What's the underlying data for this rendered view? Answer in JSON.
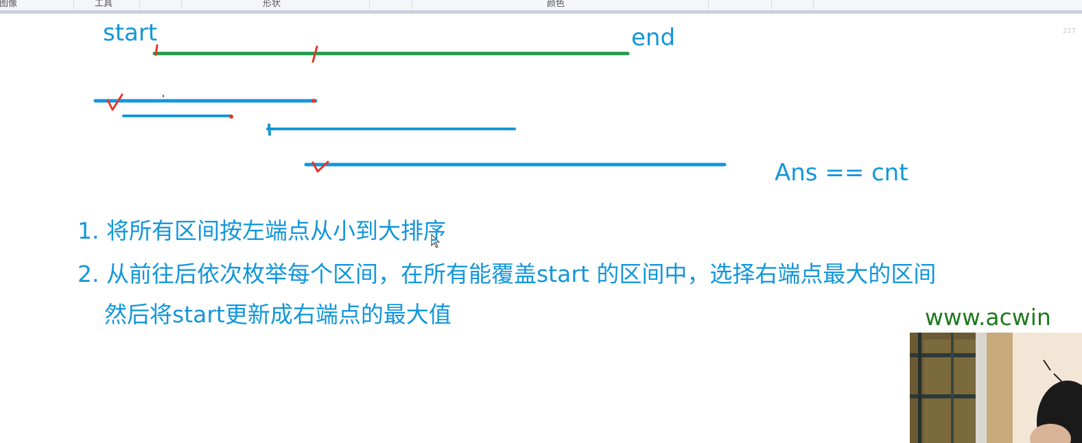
{
  "toolbar": {
    "groups": [
      "图像",
      "工具",
      "形状",
      "颜色"
    ]
  },
  "page_indicator": "227",
  "drawing": {
    "start_label": "start",
    "end_label": "end",
    "formula": "Ans == cnt",
    "colors": {
      "primary_text": "#1296db",
      "target_segment": "#1f9a48",
      "interval_segment": "#1296db",
      "annotation_marks": "#e8332a"
    }
  },
  "steps": {
    "step1": "1. 将所有区间按左端点从小到大排序",
    "step2": "2. 从前往后依次枚举每个区间，在所有能覆盖start 的区间中，选择右端点最大的区间",
    "step2_cont": "然后将start更新成右端点的最大值"
  },
  "watermark": "www.acwin"
}
